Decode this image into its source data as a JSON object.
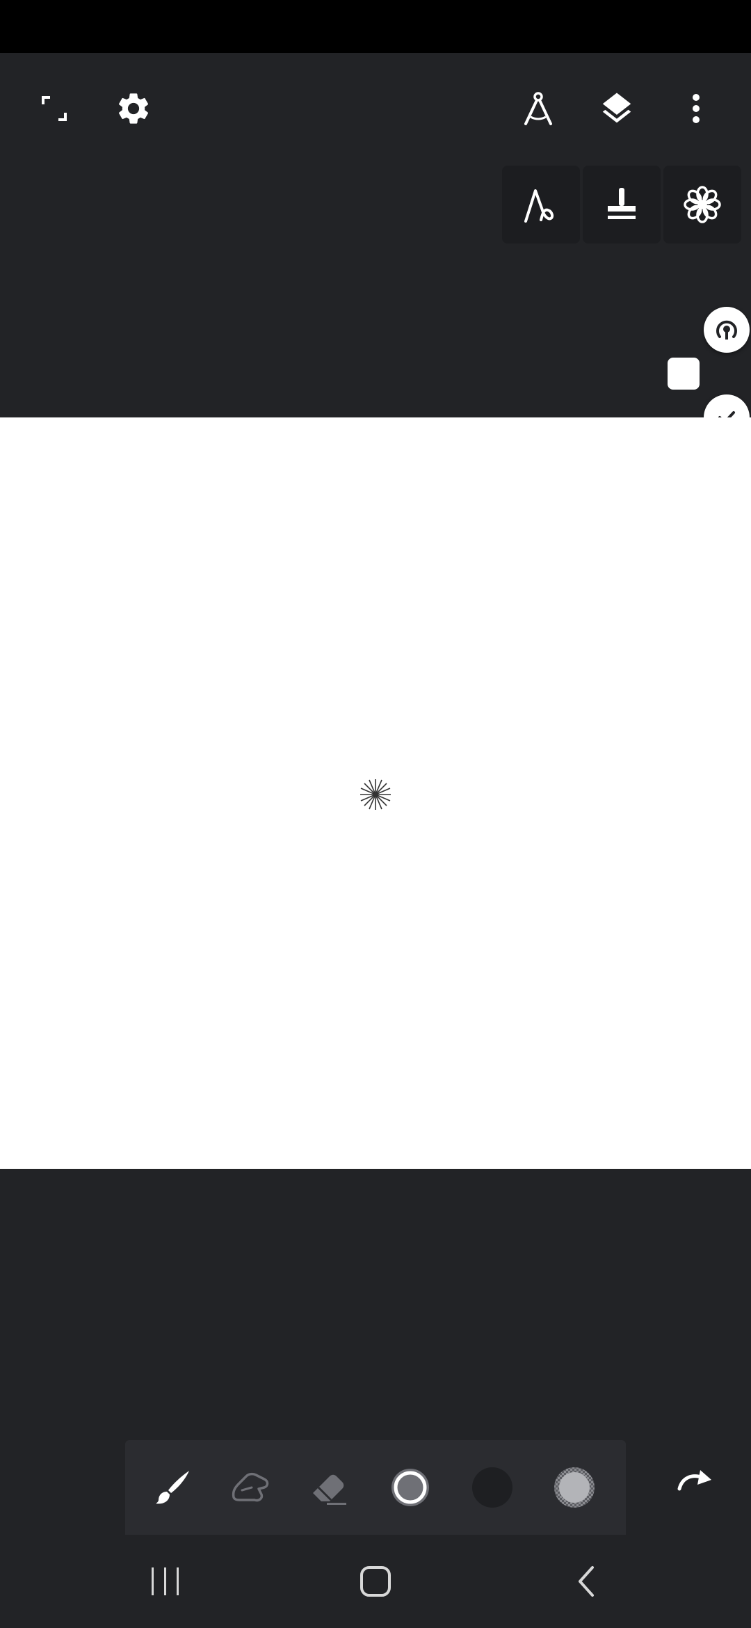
{
  "icons": {
    "fullscreen": "fullscreen-icon",
    "settings": "gear-icon",
    "ruler": "compass-icon",
    "layers": "layers-icon",
    "more": "more-vert-icon",
    "stroke_mode": "stroke-icon",
    "stamp_mode": "stamp-icon",
    "symmetry_mode": "flower-icon",
    "pointer": "pointer-icon",
    "confirm": "check-icon",
    "brush": "brush-icon",
    "smudge": "smudge-icon",
    "eraser": "eraser-icon",
    "brush_size": "brush-size-icon",
    "color": "color-swatch-icon",
    "opacity": "opacity-icon",
    "redo": "redo-icon",
    "nav_recents": "recents-icon",
    "nav_home": "home-icon",
    "nav_back": "back-icon"
  },
  "colors": {
    "background": "#222326",
    "status_bar": "#000000",
    "canvas": "#ffffff",
    "toolbar": "#2b2c30",
    "mode_button": "#1c1d20",
    "current_color": "#1e1f22",
    "icon": "#ffffff",
    "icon_dim": "#6f7076"
  }
}
